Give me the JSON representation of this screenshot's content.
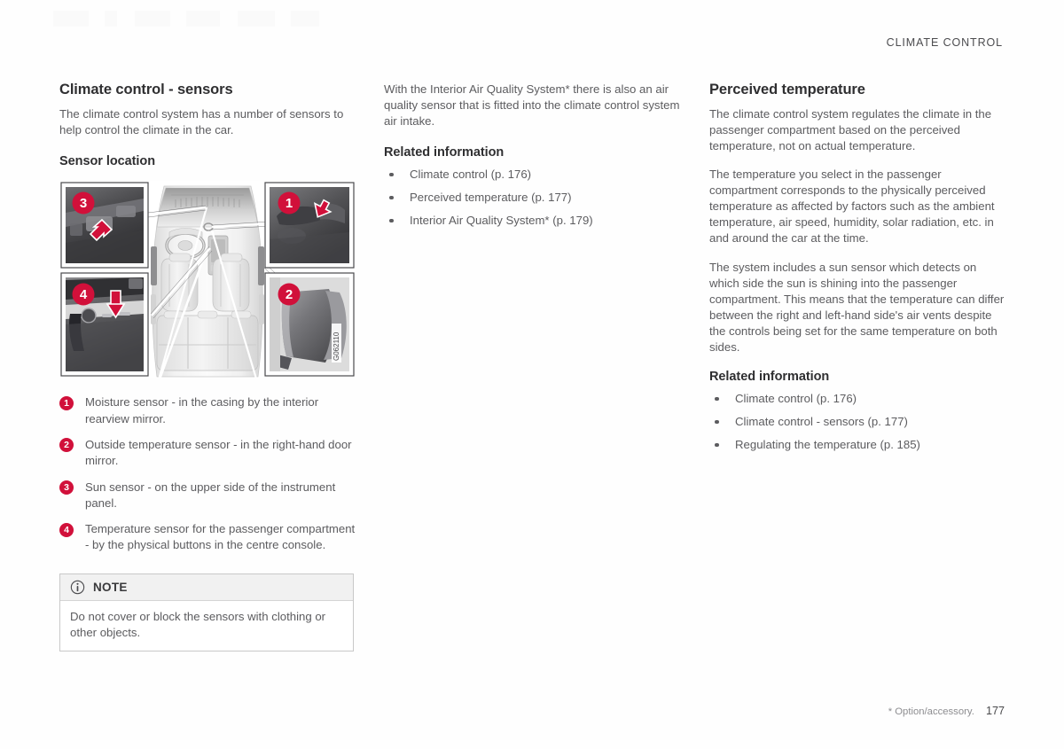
{
  "header": {
    "running_head": "CLIMATE CONTROL"
  },
  "left_column": {
    "title": "Climate control - sensors",
    "intro": "The climate control system has a number of sensors to help control the climate in the car.",
    "sensor_location_heading": "Sensor location",
    "figure": {
      "figure_id": "G062110",
      "callouts": [
        {
          "number": "1",
          "position": "top-right",
          "caption_ref": "Moisture sensor"
        },
        {
          "number": "2",
          "position": "bottom-right",
          "caption_ref": "Outside temperature sensor"
        },
        {
          "number": "3",
          "position": "top-left",
          "caption_ref": "Sun sensor"
        },
        {
          "number": "4",
          "position": "bottom-left",
          "caption_ref": "Temperature sensor passenger compartment"
        }
      ]
    },
    "legend": [
      {
        "number": "1",
        "text": "Moisture sensor - in the casing by the interior rearview mirror."
      },
      {
        "number": "2",
        "text": "Outside temperature sensor - in the right-hand door mirror."
      },
      {
        "number": "3",
        "text": "Sun sensor - on the upper side of the instrument panel."
      },
      {
        "number": "4",
        "text": "Temperature sensor for the passenger compartment - by the physical buttons in the centre console."
      }
    ],
    "note": {
      "icon": "info-circle-icon",
      "title": "NOTE",
      "text": "Do not cover or block the sensors with clothing or other objects."
    }
  },
  "middle_column": {
    "paragraph": "With the Interior Air Quality System* there is also an air quality sensor that is fitted into the climate control system air intake.",
    "related_information_heading": "Related information",
    "related_links": [
      "Climate control (p. 176)",
      "Perceived temperature (p. 177)",
      "Interior Air Quality System* (p. 179)"
    ]
  },
  "right_column": {
    "title": "Perceived temperature",
    "paragraphs": [
      "The climate control system regulates the climate in the passenger compartment based on the perceived temperature, not on actual temperature.",
      "The temperature you select in the passenger compartment corresponds to the physically perceived temperature as affected by factors such as the ambient temperature, air speed, humidity, solar radiation, etc. in and around the car at the time.",
      "The system includes a sun sensor which detects on which side the sun is shining into the passenger compartment. This means that the temperature can differ between the right and left-hand side's air vents despite the controls being set for the same temperature on both sides."
    ],
    "related_information_heading": "Related information",
    "related_links": [
      "Climate control (p. 176)",
      "Climate control - sensors (p. 177)",
      "Regulating the temperature (p. 185)"
    ]
  },
  "footer": {
    "option_note": "* Option/accessory.",
    "page_number": "177"
  },
  "colors": {
    "badge_red": "#d1103a",
    "text_gray": "#5c5c5f",
    "heading_dark": "#2f2f31",
    "note_header_bg": "#f1f1f1",
    "note_border": "#c8c8c8"
  }
}
